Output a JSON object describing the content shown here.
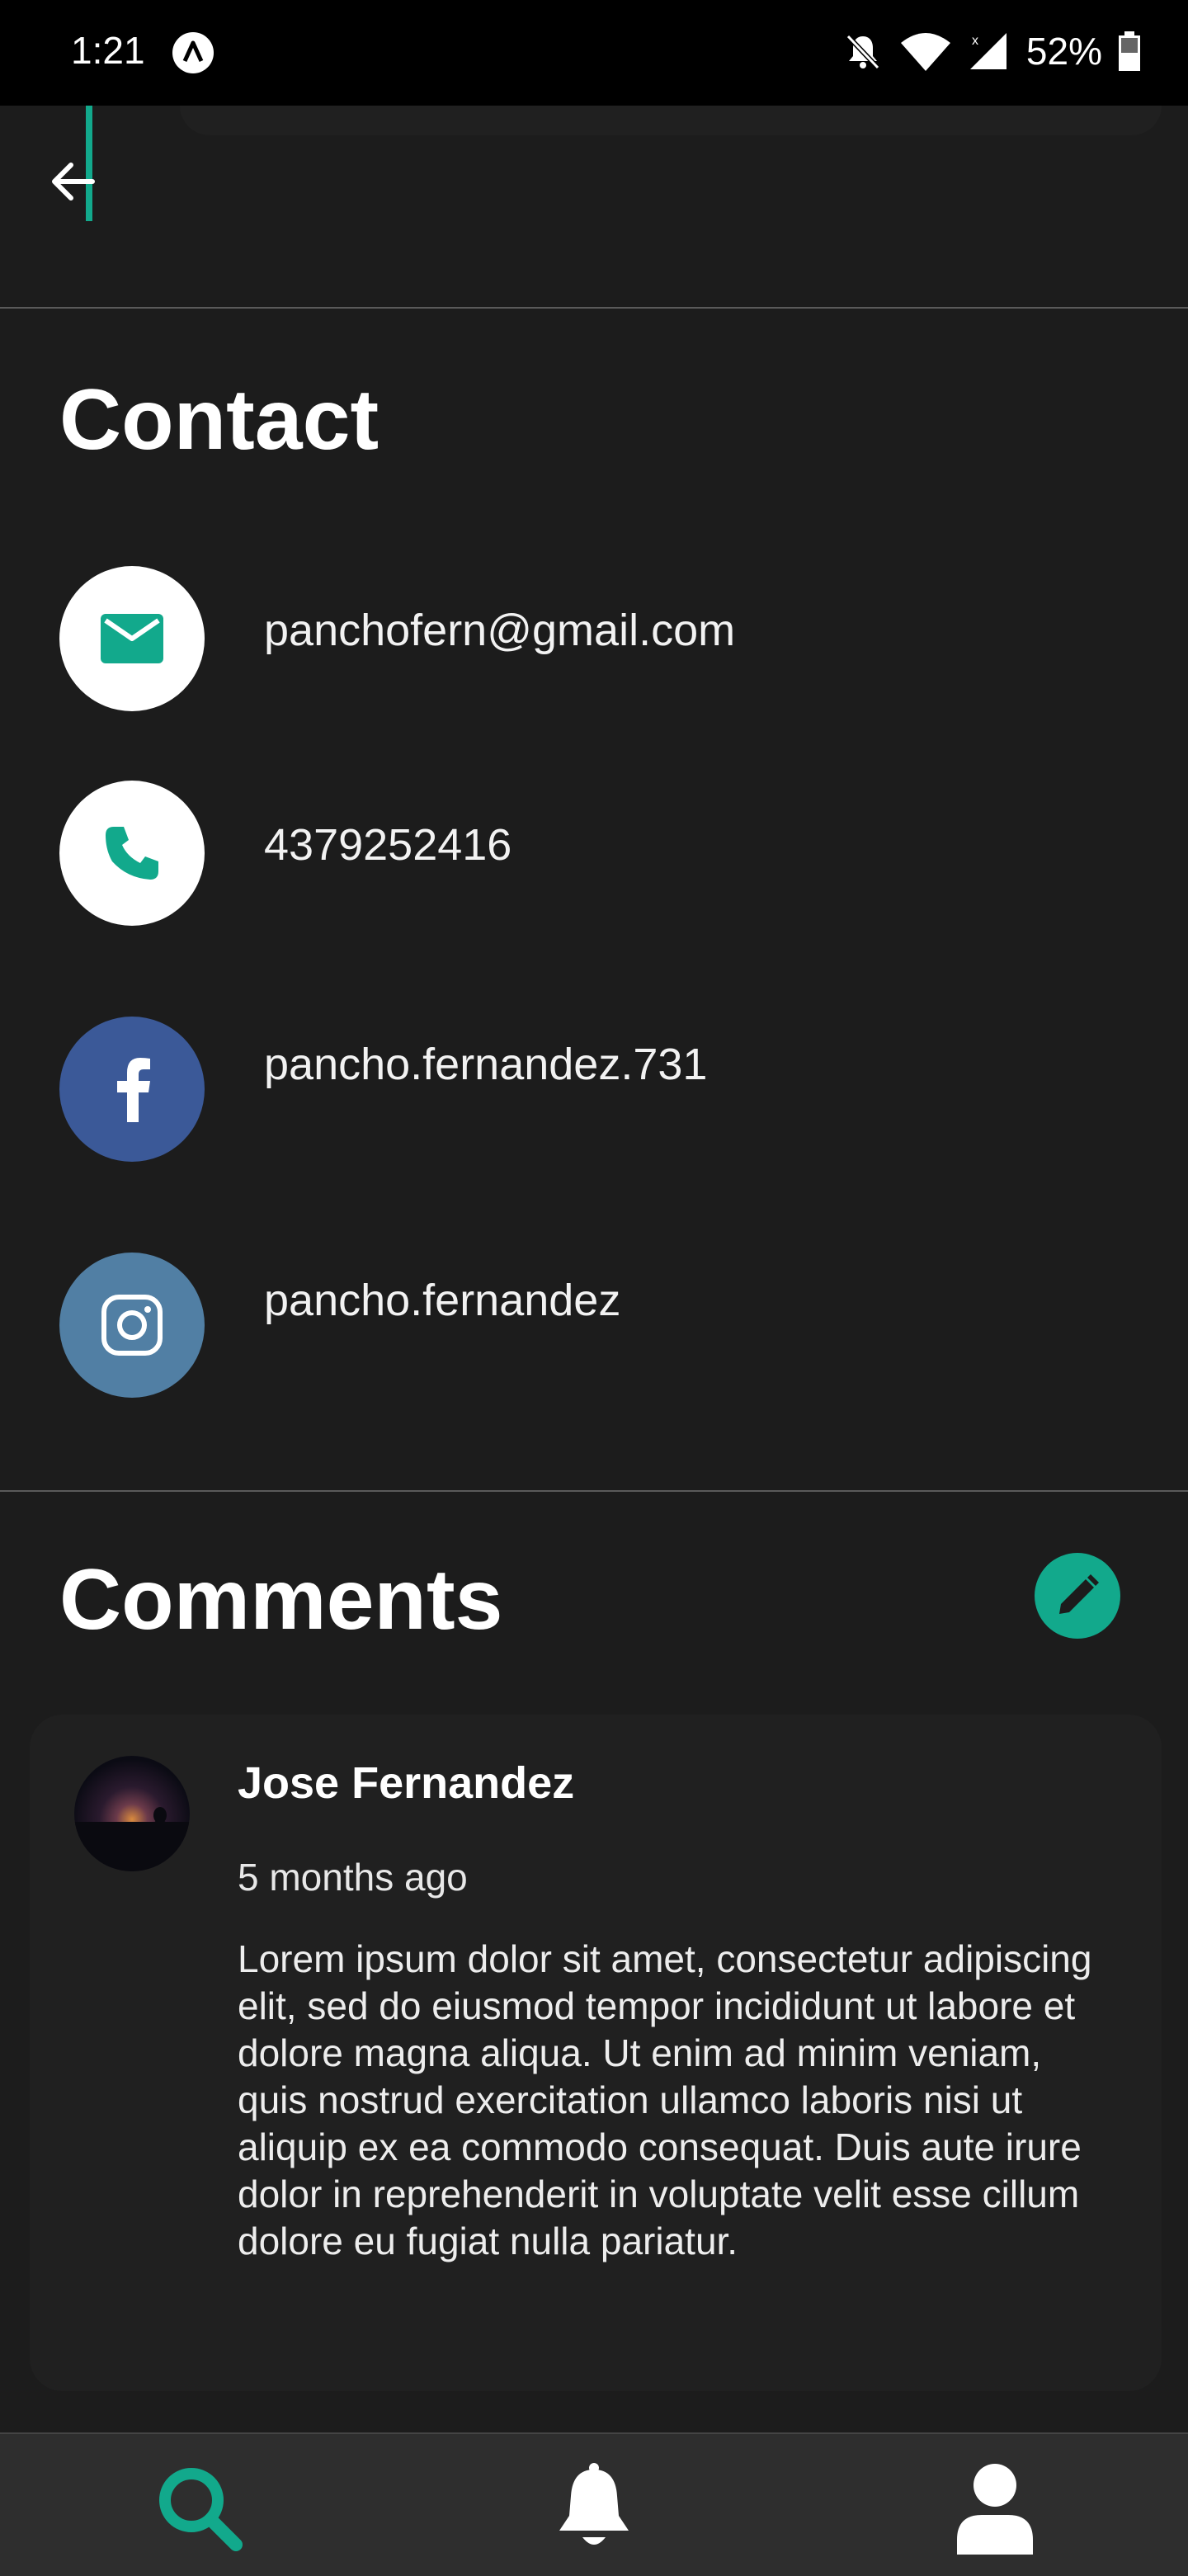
{
  "status_bar": {
    "time": "1:21",
    "battery": "52%"
  },
  "contact": {
    "title": "Contact",
    "items": [
      {
        "type": "email",
        "icon": "mail-icon",
        "value": "panchofern@gmail.com",
        "icon_bg": "#ffffff",
        "icon_color": "#12a98c"
      },
      {
        "type": "phone",
        "icon": "phone-icon",
        "value": "4379252416",
        "icon_bg": "#ffffff",
        "icon_color": "#12a98c"
      },
      {
        "type": "facebook",
        "icon": "facebook-icon",
        "value": "pancho.fernandez.731",
        "icon_bg": "#3b5998",
        "icon_color": "#ffffff"
      },
      {
        "type": "instagram",
        "icon": "instagram-icon",
        "value": "pancho.fernandez",
        "icon_bg": "#517fa4",
        "icon_color": "#ffffff"
      }
    ]
  },
  "comments": {
    "title": "Comments",
    "items": [
      {
        "author": "Jose Fernandez",
        "time": "5 months ago",
        "body": "Lorem ipsum dolor sit amet, consectetur adipiscing elit, sed do eiusmod tempor incididunt ut labore et dolore magna aliqua. Ut enim ad minim veniam, quis nostrud exercitation ullamco laboris nisi ut aliquip ex ea commodo consequat. Duis aute irure dolor in reprehenderit in voluptate velit esse cillum dolore eu fugiat nulla pariatur."
      }
    ]
  },
  "bottom_nav": [
    {
      "icon": "search-icon",
      "active": true
    },
    {
      "icon": "bell-icon",
      "active": false
    },
    {
      "icon": "profile-icon",
      "active": false
    }
  ],
  "colors": {
    "accent": "#12a98c",
    "background": "#1c1c1c",
    "card": "#202020"
  }
}
